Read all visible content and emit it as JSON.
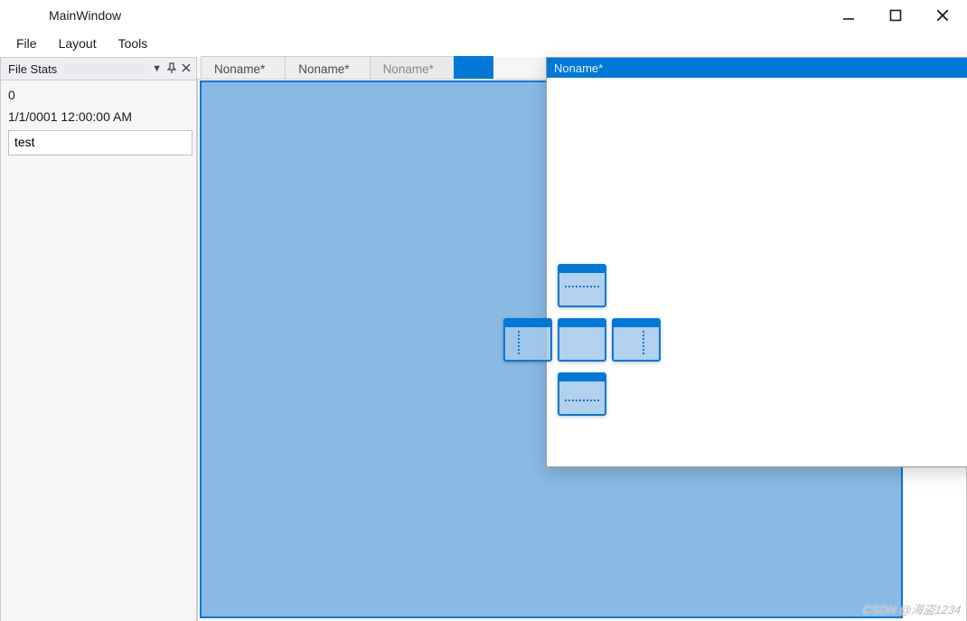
{
  "window": {
    "title": "MainWindow"
  },
  "menu": {
    "items": [
      "File",
      "Layout",
      "Tools"
    ]
  },
  "sidePanel": {
    "title": "File Stats",
    "fileCount": "0",
    "timestamp": "1/1/0001 12:00:00 AM",
    "inputValue": "test"
  },
  "tabs": {
    "items": [
      {
        "label": "Noname*",
        "state": "inactive"
      },
      {
        "label": "Noname*",
        "state": "inactive"
      },
      {
        "label": "Noname*",
        "state": "dim"
      },
      {
        "label": "",
        "state": "drag-target"
      }
    ]
  },
  "floatingDoc": {
    "title": "Noname*"
  },
  "dockCompass": {
    "positions": [
      "top",
      "left",
      "center",
      "right",
      "bottom"
    ]
  },
  "watermark": "CSDN @海盗1234"
}
